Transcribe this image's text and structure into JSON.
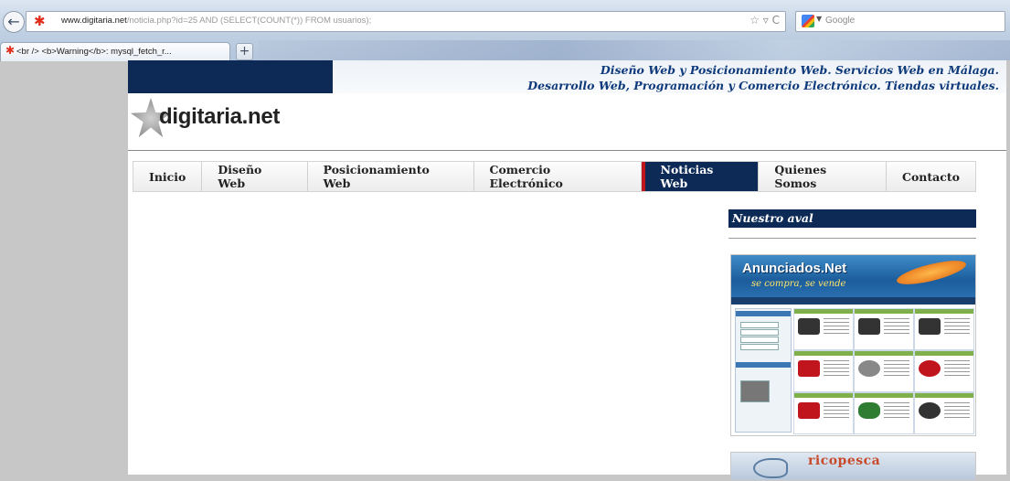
{
  "browser": {
    "url_domain": "www.digitaria.net",
    "url_path": "/noticia.php?id=25 AND (SELECT(COUNT(*)) FROM usuarios);",
    "url_controls": "☆ ▿ C",
    "search_placeholder": "Google",
    "tab_title": "<br /> <b>Warning</b>: mysql_fetch_r...",
    "new_tab": "+",
    "back": "←",
    "star_glyph": "✱"
  },
  "header": {
    "tagline_1": "Diseño Web y Posicionamiento Web. Servicios Web en Málaga.",
    "tagline_2": "Desarrollo Web, Programación y Comercio Electrónico. Tiendas virtuales.",
    "logo_text": "digitaria.net"
  },
  "nav": {
    "items": [
      {
        "label": "Inicio"
      },
      {
        "label": "Diseño Web"
      },
      {
        "label": "Posicionamiento Web"
      },
      {
        "label": "Comercio Electrónico"
      },
      {
        "label": "Noticias Web"
      },
      {
        "label": "Quienes Somos"
      },
      {
        "label": "Contacto"
      }
    ],
    "active": "Noticias Web"
  },
  "sidebar": {
    "heading": "Nuestro aval",
    "banner_1": {
      "brand": "Anunciados.Net",
      "slogan": "se compra, se vende"
    },
    "banner_2": {
      "brand": "ricopesca"
    }
  },
  "colors": {
    "navy": "#0c2a55",
    "accent_red": "#c0151d",
    "tagline_blue": "#0e3a7b"
  }
}
